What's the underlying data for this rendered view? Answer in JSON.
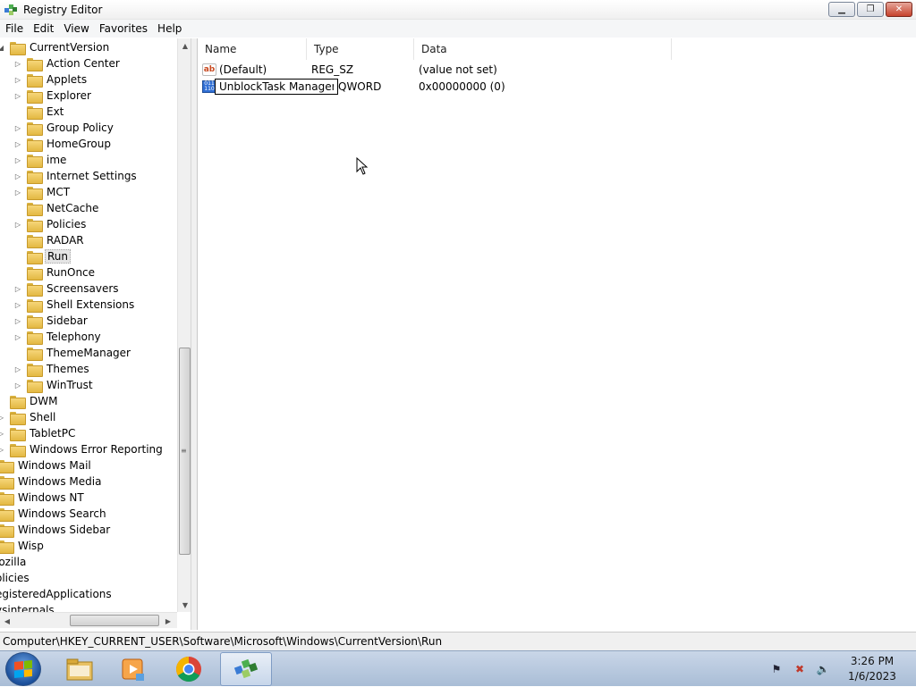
{
  "window": {
    "title": "Registry Editor"
  },
  "menu": [
    "File",
    "Edit",
    "View",
    "Favorites",
    "Help"
  ],
  "tree": {
    "items": [
      {
        "label": "CurrentVersion",
        "indent": 0,
        "expander": "open"
      },
      {
        "label": "Action Center",
        "indent": 1,
        "expander": "closed"
      },
      {
        "label": "Applets",
        "indent": 1,
        "expander": "closed"
      },
      {
        "label": "Explorer",
        "indent": 1,
        "expander": "closed"
      },
      {
        "label": "Ext",
        "indent": 1,
        "expander": "none"
      },
      {
        "label": "Group Policy",
        "indent": 1,
        "expander": "closed"
      },
      {
        "label": "HomeGroup",
        "indent": 1,
        "expander": "closed"
      },
      {
        "label": "ime",
        "indent": 1,
        "expander": "closed"
      },
      {
        "label": "Internet Settings",
        "indent": 1,
        "expander": "closed"
      },
      {
        "label": "MCT",
        "indent": 1,
        "expander": "closed"
      },
      {
        "label": "NetCache",
        "indent": 1,
        "expander": "none"
      },
      {
        "label": "Policies",
        "indent": 1,
        "expander": "closed"
      },
      {
        "label": "RADAR",
        "indent": 1,
        "expander": "none"
      },
      {
        "label": "Run",
        "indent": 1,
        "expander": "none",
        "selected": true
      },
      {
        "label": "RunOnce",
        "indent": 1,
        "expander": "none"
      },
      {
        "label": "Screensavers",
        "indent": 1,
        "expander": "closed"
      },
      {
        "label": "Shell Extensions",
        "indent": 1,
        "expander": "closed"
      },
      {
        "label": "Sidebar",
        "indent": 1,
        "expander": "closed"
      },
      {
        "label": "Telephony",
        "indent": 1,
        "expander": "closed"
      },
      {
        "label": "ThemeManager",
        "indent": 1,
        "expander": "none"
      },
      {
        "label": "Themes",
        "indent": 1,
        "expander": "closed"
      },
      {
        "label": "WinTrust",
        "indent": 1,
        "expander": "closed"
      },
      {
        "label": "DWM",
        "indent": 0,
        "expander": "none"
      },
      {
        "label": "Shell",
        "indent": 0,
        "expander": "closed"
      },
      {
        "label": "TabletPC",
        "indent": 0,
        "expander": "closed"
      },
      {
        "label": "Windows Error Reporting",
        "indent": 0,
        "expander": "closed"
      },
      {
        "label": "Windows Mail",
        "indent": -1,
        "expander": "none"
      },
      {
        "label": "Windows Media",
        "indent": -1,
        "expander": "none"
      },
      {
        "label": "Windows NT",
        "indent": -1,
        "expander": "none"
      },
      {
        "label": "Windows Search",
        "indent": -1,
        "expander": "none"
      },
      {
        "label": "Windows Sidebar",
        "indent": -1,
        "expander": "none"
      },
      {
        "label": "Wisp",
        "indent": -1,
        "expander": "none"
      },
      {
        "label": "lozilla",
        "indent": -2,
        "expander": "none"
      },
      {
        "label": "olicies",
        "indent": -2,
        "expander": "none"
      },
      {
        "label": "egisteredApplications",
        "indent": -2,
        "expander": "none"
      },
      {
        "label": "ysinternals",
        "indent": -2,
        "expander": "none"
      }
    ]
  },
  "list": {
    "columns": [
      "Name",
      "Type",
      "Data"
    ],
    "rows": [
      {
        "name": "(Default)",
        "type": "REG_SZ",
        "data": "(value not set)",
        "icon": "string-value-icon"
      },
      {
        "name": "",
        "type": "QWORD",
        "data": "0x00000000 (0)",
        "icon": "binary-value-icon"
      }
    ],
    "rename_value": "UnblockTask Manager"
  },
  "status": {
    "path": "Computer\\HKEY_CURRENT_USER\\Software\\Microsoft\\Windows\\CurrentVersion\\Run"
  },
  "taskbar": {
    "apps": [
      "explorer-icon",
      "media-player-icon",
      "chrome-icon",
      "regedit-icon"
    ],
    "clock_time": "3:26 PM",
    "clock_date": "1/6/2023"
  }
}
